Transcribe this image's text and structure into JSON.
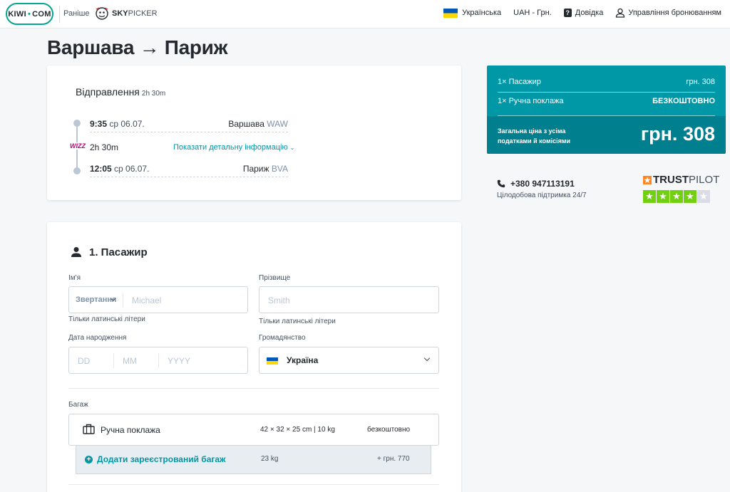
{
  "header": {
    "logo_text": "KIWI",
    "logo_suffix": "COM",
    "formerly": "Раніше",
    "partner_bold": "SKY",
    "partner_rest": "PICKER",
    "language": "Українська",
    "currency": "UAH - Грн.",
    "help": "Довідка",
    "manage_bookings": "Управління бронюванням"
  },
  "page": {
    "title": "Варшава → Париж"
  },
  "flight": {
    "section_label": "Відправлення",
    "section_duration": "2h 30m",
    "airline": "WIZZ",
    "departure": {
      "time": "9:35",
      "date": "ср 06.07.",
      "city": "Варшава",
      "code": "WAW"
    },
    "duration": "2h 30m",
    "details_link": "Показати детальну інформацію",
    "arrival": {
      "time": "12:05",
      "date": "ср 06.07.",
      "city": "Париж",
      "code": "BVA"
    }
  },
  "passenger": {
    "title": "1. Пасажир",
    "first_name_label": "Ім'я",
    "title_select": "Звертання",
    "first_name_placeholder": "Michael",
    "last_name_label": "Прізвище",
    "last_name_placeholder": "Smith",
    "latin_hint": "Тільки латинські літери",
    "dob_label": "Дата народження",
    "dob_dd": "DD",
    "dob_mm": "MM",
    "dob_yyyy": "YYYY",
    "nationality_label": "Громадянство",
    "nationality_value": "Україна"
  },
  "baggage": {
    "label": "Багаж",
    "hand": {
      "name": "Ручна поклажа",
      "dims": "42 × 32 × 25 cm | 10 kg",
      "price": "безкоштовно"
    },
    "add": {
      "label": "Додати зареєстрований багаж",
      "weight": "23 kg",
      "price": "+ грн. 770"
    }
  },
  "summary": {
    "passenger_label": "1× Пасажир",
    "passenger_price": "грн. 308",
    "hand_label": "1× Ручна поклажа",
    "hand_price": "БЕЗКОШТОВНО",
    "total_label": "Загальна ціна з усіма податками й комісіями",
    "total_value": "грн. 308"
  },
  "support": {
    "phone": "+380 947113191",
    "hours": "Цілодобова підтримка 24/7",
    "trustpilot_bold": "TRUST",
    "trustpilot_rest": "PILOT",
    "rating_stars": 4,
    "rating_max": 5
  },
  "colors": {
    "accent": "#0097a7",
    "accent_dark": "#007f8f",
    "trustpilot_green": "#73cf11",
    "wizz": "#c6007e"
  }
}
